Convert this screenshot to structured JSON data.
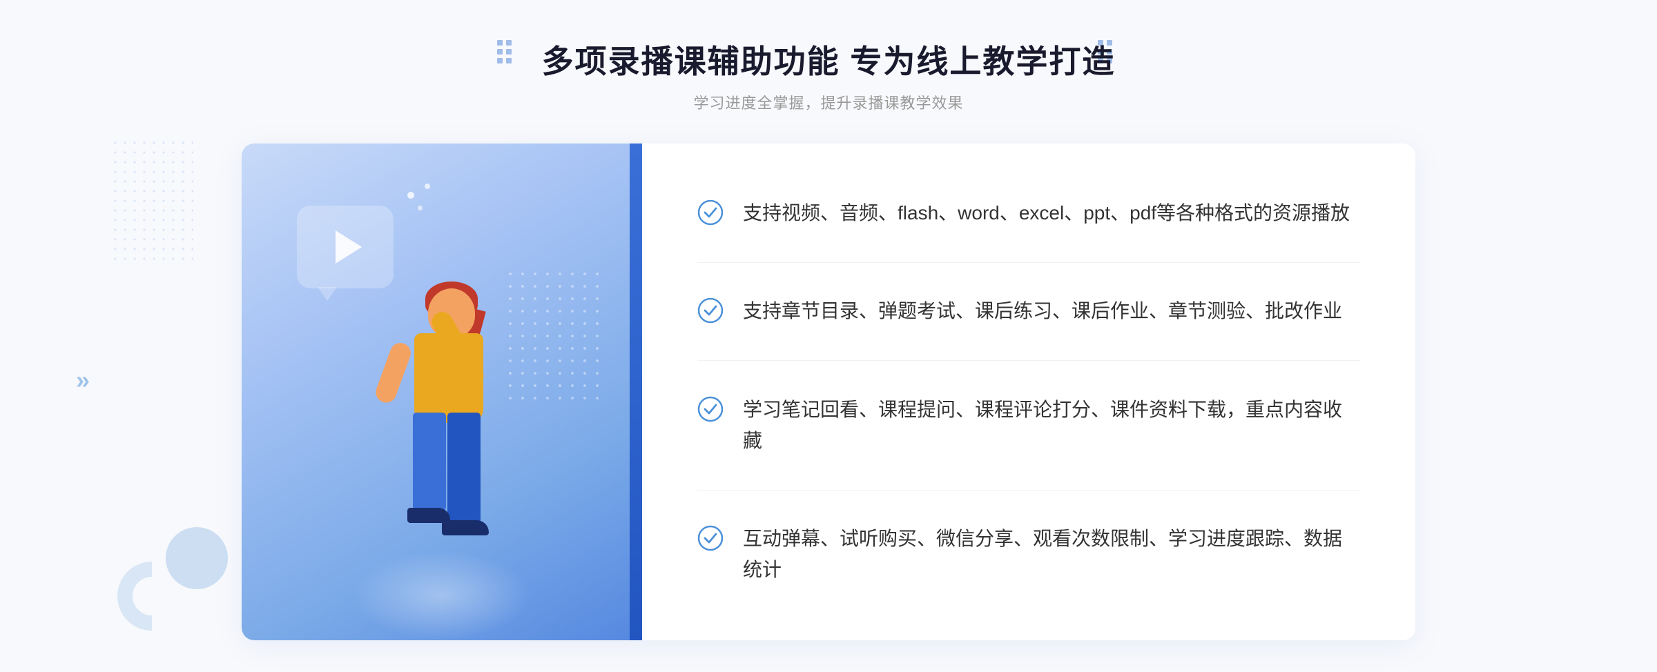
{
  "page": {
    "background": "#f8f9fc"
  },
  "header": {
    "main_title": "多项录播课辅助功能 专为线上教学打造",
    "sub_title": "学习进度全掌握，提升录播课教学效果"
  },
  "decorations": {
    "chevron_left": "»",
    "dots_title_count": 4
  },
  "features": [
    {
      "id": 1,
      "text": "支持视频、音频、flash、word、excel、ppt、pdf等各种格式的资源播放"
    },
    {
      "id": 2,
      "text": "支持章节目录、弹题考试、课后练习、课后作业、章节测验、批改作业"
    },
    {
      "id": 3,
      "text": "学习笔记回看、课程提问、课程评论打分、课件资料下载，重点内容收藏"
    },
    {
      "id": 4,
      "text": "互动弹幕、试听购买、微信分享、观看次数限制、学习进度跟踪、数据统计"
    }
  ],
  "colors": {
    "primary_blue": "#3a6fd8",
    "light_blue": "#7baae8",
    "accent": "#4a90d9",
    "check_circle": "#4a90d9",
    "text_dark": "#1a1a2e",
    "text_gray": "#999"
  }
}
